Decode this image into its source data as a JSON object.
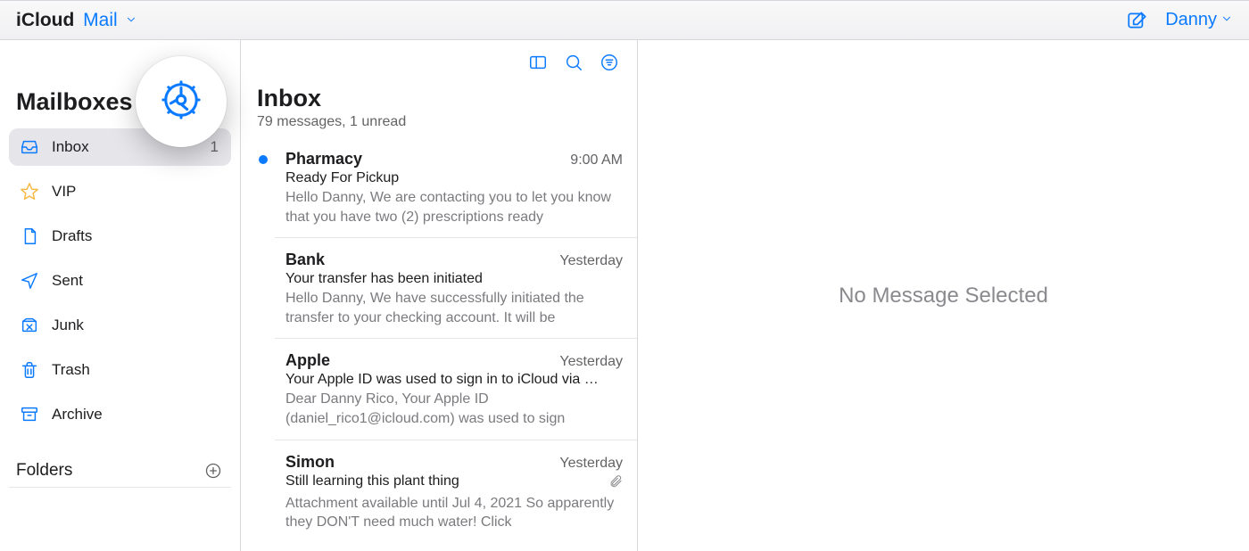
{
  "header": {
    "brand_prefix": "iCloud",
    "brand_app": "Mail",
    "user_name": "Danny"
  },
  "sidebar": {
    "title": "Mailboxes",
    "folders_label": "Folders",
    "items": [
      {
        "label": "Inbox",
        "badge": "1",
        "icon": "inbox-icon",
        "selected": true
      },
      {
        "label": "VIP",
        "badge": "",
        "icon": "star-icon",
        "selected": false
      },
      {
        "label": "Drafts",
        "badge": "",
        "icon": "drafts-icon",
        "selected": false
      },
      {
        "label": "Sent",
        "badge": "",
        "icon": "sent-icon",
        "selected": false
      },
      {
        "label": "Junk",
        "badge": "",
        "icon": "junk-icon",
        "selected": false
      },
      {
        "label": "Trash",
        "badge": "",
        "icon": "trash-icon",
        "selected": false
      },
      {
        "label": "Archive",
        "badge": "",
        "icon": "archive-icon",
        "selected": false
      }
    ]
  },
  "list": {
    "title": "Inbox",
    "subtitle": "79 messages, 1 unread",
    "messages": [
      {
        "sender": "Pharmacy",
        "when": "9:00 AM",
        "subject": "Ready For Pickup",
        "preview": "Hello Danny, We are contacting you to let you know that you have two (2) prescriptions ready",
        "unread": true,
        "attachment": false
      },
      {
        "sender": "Bank",
        "when": "Yesterday",
        "subject": "Your transfer has been initiated",
        "preview": "Hello Danny, We have successfully initiated the transfer to your checking account. It will be",
        "unread": false,
        "attachment": false
      },
      {
        "sender": "Apple",
        "when": "Yesterday",
        "subject": "Your Apple ID was used to sign in to iCloud via …",
        "preview": "Dear Danny Rico, Your Apple ID (daniel_rico1@icloud.com) was used to sign",
        "unread": false,
        "attachment": false
      },
      {
        "sender": "Simon",
        "when": "Yesterday",
        "subject": "Still learning this plant thing",
        "preview": "Attachment available until Jul 4, 2021 So apparently they DON'T need much water! Click",
        "unread": false,
        "attachment": true
      }
    ]
  },
  "detail": {
    "empty_text": "No Message Selected"
  }
}
